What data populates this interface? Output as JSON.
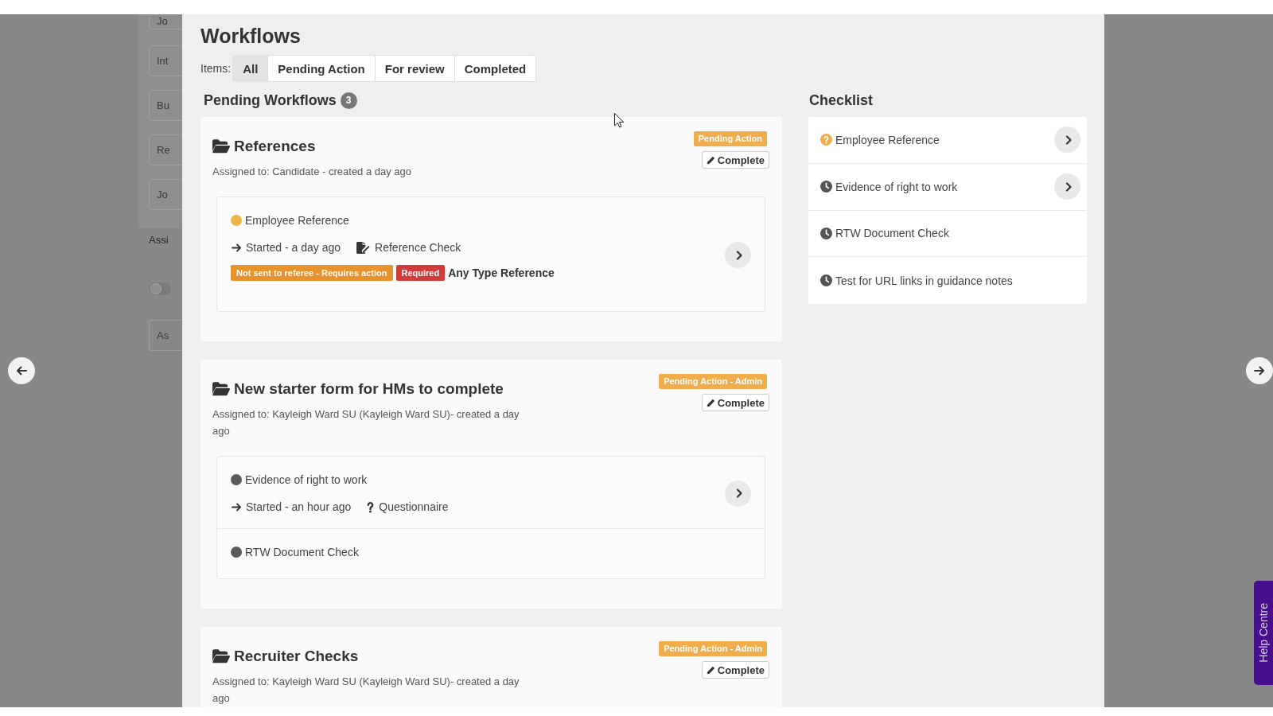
{
  "backdrop": {
    "fields": [
      "Jo",
      "Int",
      "Bu",
      "Re",
      "Jo"
    ],
    "heading": "Assi",
    "toggle": {
      "on": false
    },
    "field": "As"
  },
  "modal": {
    "title": "Workflows",
    "filter_label": "Items:",
    "tabs": [
      {
        "label": "All",
        "selected": true
      },
      {
        "label": "Pending Action",
        "selected": false
      },
      {
        "label": "For review",
        "selected": false
      },
      {
        "label": "Completed",
        "selected": false
      }
    ]
  },
  "pending": {
    "title": "Pending Workflows",
    "count": "3",
    "workflows": [
      {
        "title": "References",
        "assigned": "Assigned to: Candidate - created a day ago",
        "status": "Pending Action",
        "action": "Complete",
        "items": [
          {
            "name": "Employee Reference",
            "color": "#f0b44c",
            "started": "Started - a day ago",
            "type": {
              "kind": "document",
              "label": "Reference Check"
            },
            "tags": [
              {
                "text": "Not sent to referee - Requires action",
                "color": "#e8922d"
              },
              {
                "text": "Required",
                "color": "#d13b3b"
              }
            ],
            "note": "Any Type Reference",
            "openable": true
          }
        ]
      },
      {
        "title": "New starter form for HMs to complete",
        "assigned": "Assigned to: Kayleigh Ward SU (Kayleigh Ward SU)- created a day ago",
        "status": "Pending Action - Admin",
        "action": "Complete",
        "items": [
          {
            "name": "Evidence of right to work",
            "color": "#5a5a5a",
            "started": "Started - an hour ago",
            "type": {
              "kind": "question",
              "label": "Questionnaire"
            },
            "openable": true
          },
          {
            "name": "RTW Document Check",
            "color": "#5a5a5a",
            "openable": false
          }
        ]
      },
      {
        "title": "Recruiter Checks",
        "assigned": "Assigned to: Kayleigh Ward SU (Kayleigh Ward SU)- created a day ago",
        "status": "Pending Action - Admin",
        "action": "Complete"
      }
    ]
  },
  "checklist": {
    "title": "Checklist",
    "items": [
      {
        "kind": "question",
        "label": "Employee Reference",
        "openable": true
      },
      {
        "kind": "clock",
        "label": "Evidence of right to work",
        "openable": true
      },
      {
        "kind": "clock",
        "label": "RTW Document Check",
        "openable": false
      },
      {
        "kind": "clock",
        "label": "Test for URL links in guidance notes",
        "openable": false
      }
    ]
  },
  "help_tab": "Help Centre"
}
